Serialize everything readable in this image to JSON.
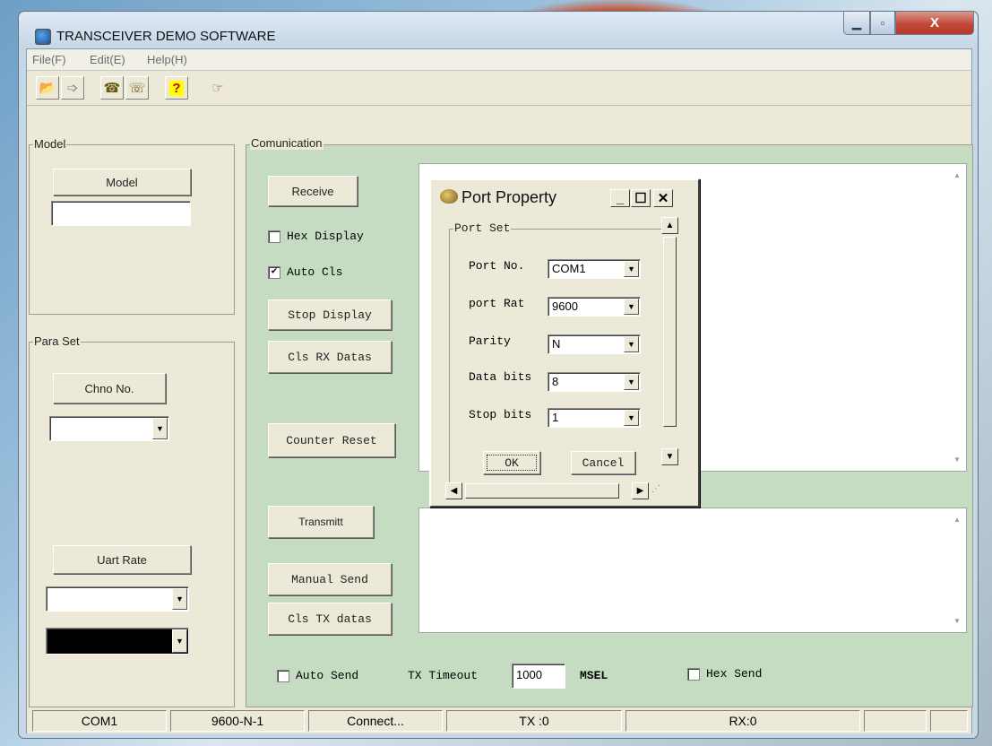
{
  "window": {
    "title": "TRANSCEIVER DEMO SOFTWARE",
    "min": "—",
    "max": "☐",
    "close": "X"
  },
  "menu": [
    "File(F)",
    "Edit(E)",
    "Help(H)"
  ],
  "toolbar_icons": [
    "open-file-icon",
    "save-file-icon",
    "phone-connect-icon",
    "phone-disconnect-icon",
    "help-icon",
    "pointing-hand-icon"
  ],
  "model_group": {
    "label": "Model",
    "button": "Model",
    "value": ""
  },
  "para_group": {
    "label": "Para Set",
    "chno_button": "Chno No.",
    "chno_value": "",
    "uart_button": "Uart Rate",
    "uart_value": "",
    "extra_value": ""
  },
  "comm": {
    "label": "Comunication",
    "receive": "Receive",
    "hex_display": {
      "label": "Hex Display",
      "checked": false
    },
    "auto_cls": {
      "label": "Auto Cls",
      "checked": true
    },
    "stop_display": "Stop Display",
    "cls_rx": "Cls RX Datas",
    "counter_reset": "Counter Reset",
    "transmit": "Transmitt",
    "manual_send": "Manual Send",
    "cls_tx": "Cls TX datas",
    "auto_send": {
      "label": "Auto Send",
      "checked": false
    },
    "tx_timeout_label": "TX Timeout",
    "tx_timeout_value": "1000",
    "msel": "MSEL",
    "hex_send": {
      "label": "Hex Send",
      "checked": false
    }
  },
  "status": {
    "port": "COM1",
    "setting": "9600-N-1",
    "state": "Connect...",
    "tx": "TX :0",
    "rx": "RX:0",
    "extra1": "",
    "extra2": ""
  },
  "dialog": {
    "title": "Port Property",
    "group": "Port Set",
    "fields": [
      {
        "label": "Port No.",
        "value": "COM1"
      },
      {
        "label": "port Rat",
        "value": "9600"
      },
      {
        "label": "Parity",
        "value": "N"
      },
      {
        "label": "Data bits",
        "value": "8"
      },
      {
        "label": "Stop bits",
        "value": "1"
      }
    ],
    "ok": "OK",
    "cancel": "Cancel"
  }
}
